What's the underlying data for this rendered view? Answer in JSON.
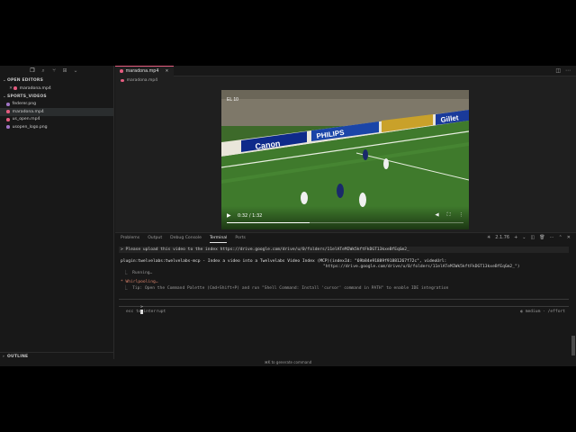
{
  "activity_bar": {
    "icons": [
      "files-icon",
      "search-icon",
      "source-control-icon",
      "extensions-icon",
      "chevron-down-icon"
    ]
  },
  "sidebar": {
    "open_editors": {
      "title": "OPEN EDITORS",
      "items": [
        {
          "label": "maradona.mp4",
          "type": "mp4"
        }
      ]
    },
    "folder": {
      "title": "SPORTS_VIDEOS",
      "items": [
        {
          "label": "federer.png",
          "type": "png",
          "selected": false
        },
        {
          "label": "maradona.mp4",
          "type": "mp4",
          "selected": true
        },
        {
          "label": "us_open.mp4",
          "type": "mp4",
          "selected": false
        },
        {
          "label": "usopen_logo.png",
          "type": "png",
          "selected": false
        }
      ]
    },
    "outline": "OUTLINE",
    "timeline": "TIMELINE"
  },
  "editor": {
    "tab_label": "maradona.mp4",
    "breadcrumb": "maradona.mp4",
    "video": {
      "current_time": "0:32 / 1:32",
      "progress_fraction": 0.348,
      "watermark": "EL 10",
      "billboards": [
        "Canon",
        "PHILIPS",
        "Gillet"
      ]
    }
  },
  "panel": {
    "tabs": [
      "Problems",
      "Output",
      "Debug Console",
      "Terminal",
      "Ports"
    ],
    "active_tab": "Terminal",
    "terminal_instance": "2.1.76",
    "lines": {
      "user_msg": "> Please upload this video to the index https://drive.google.com/drive/u/0/folders/11elATeMIWk5kftFkDGT13kxeBfEqGm2_",
      "tool_call": "plugin:twelvelabs:twelvelabs-mcp - Index a video into a Twelvelabs Video Index (MCP)(indexId: \"69b84e91889f91881267f72c\", videoUrl:",
      "tool_call_cont": "\"https://drive.google.com/drive/u/0/folders/11elATeMIWk5kftFkDGT13kxeBfEqGm2_\")",
      "running": "⎿  Running…",
      "status": "* Whirlpooling…",
      "tip": "⎿  Tip: Open the Command Palette (Cmd+Shift+P) and run \"Shell Command: Install 'cursor' command in PATH\" to enable IDE integration",
      "prompt_symbol": ">",
      "hint_left": "esc to interrupt",
      "hint_right": "◐ medium · /effort"
    },
    "colors": {
      "status_orange": "#d9826b",
      "accent_pink": "#e45c7f"
    }
  },
  "statusbar": {
    "center": "⌘K to generate command"
  }
}
